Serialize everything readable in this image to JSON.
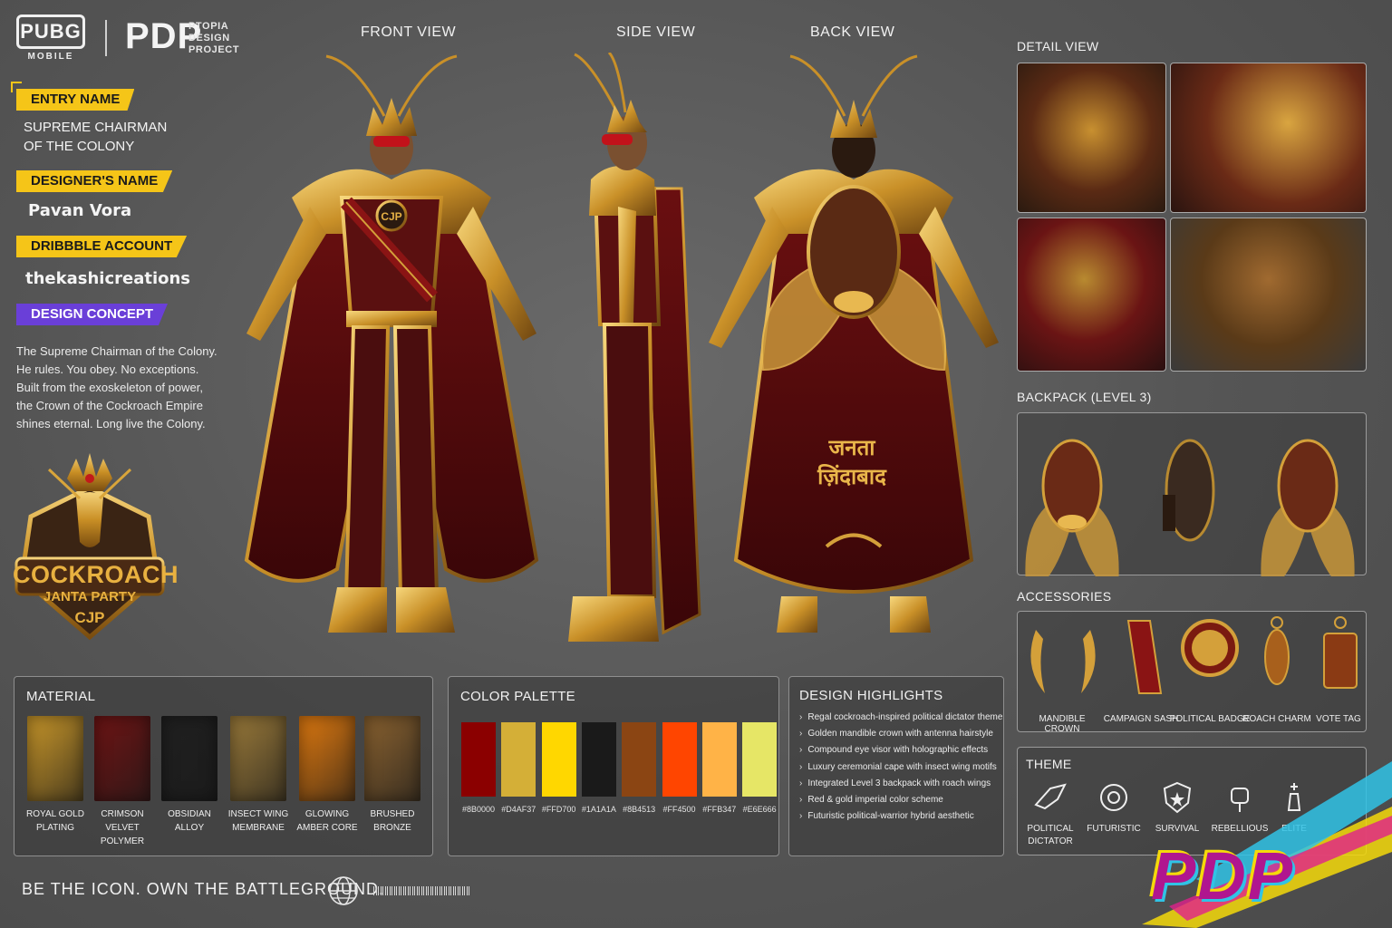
{
  "header": {
    "pubg_logo": "PUBG",
    "pubg_sub": "MOBILE",
    "pdp_logo": "PDP",
    "pdp_sub_1": "PTOPIA",
    "pdp_sub_2": "DESIGN",
    "pdp_sub_3": "PROJECT"
  },
  "entry": {
    "entry_tag": "ENTRY NAME",
    "entry_line1": "SUPREME CHAIRMAN",
    "entry_line2": "OF THE COLONY",
    "designer_tag": "DESIGNER'S NAME",
    "designer": "Pavan Vora",
    "dribbble_tag": "DRIBBBLE ACCOUNT",
    "dribbble": "thekashicreations",
    "concept_tag": "DESIGN CONCEPT",
    "concept": "The Supreme Chairman of the Colony. He rules. You obey. No exceptions. Built from the exoskeleton of power, the Crown of the Cockroach Empire shines eternal. Long live the Colony."
  },
  "emblem": {
    "line1": "COCKROACH",
    "line2": "JANTA PARTY",
    "line3": "CJP"
  },
  "views": {
    "front": "FRONT VIEW",
    "side": "SIDE VIEW",
    "back": "BACK VIEW",
    "chest_badge": "CJP",
    "cape_text_1": "जनता",
    "cape_text_2": "ज़िंदाबाद"
  },
  "detail": {
    "title": "DETAIL VIEW"
  },
  "backpack": {
    "title": "BACKPACK (LEVEL 3)"
  },
  "accessories": {
    "title": "ACCESSORIES",
    "items": [
      "MANDIBLE CROWN",
      "CAMPAIGN SASH",
      "POLITICAL BADGE",
      "ROACH CHARM",
      "VOTE TAG"
    ]
  },
  "material": {
    "title": "MATERIAL",
    "items": [
      {
        "l1": "ROYAL GOLD",
        "l2": "PLATING",
        "color": "#c9972a"
      },
      {
        "l1": "CRIMSON VELVET",
        "l2": "POLYMER",
        "color": "#6e1414"
      },
      {
        "l1": "OBSIDIAN",
        "l2": "ALLOY",
        "color": "#202020"
      },
      {
        "l1": "INSECT WING",
        "l2": "MEMBRANE",
        "color": "#9a7a3a"
      },
      {
        "l1": "GLOWING",
        "l2": "AMBER CORE",
        "color": "#e07a10"
      },
      {
        "l1": "BRUSHED",
        "l2": "BRONZE",
        "color": "#8a6230"
      }
    ]
  },
  "palette": {
    "title": "COLOR PALETTE",
    "colors": [
      "#8B0000",
      "#D4AF37",
      "#FFD700",
      "#1A1A1A",
      "#8B4513",
      "#FF4500",
      "#FFB347",
      "#E6E666"
    ],
    "labels": [
      "#8B0000",
      "#D4AF37",
      "#FFD700",
      "#1A1A1A",
      "#8B4513",
      "#FF4500",
      "#FFB347",
      "#E6E666"
    ]
  },
  "highlights": {
    "title": "DESIGN HIGHLIGHTS",
    "items": [
      "Regal cockroach-inspired political dictator theme",
      "Golden mandible crown with antenna hairstyle",
      "Compound eye visor with holographic effects",
      "Luxury ceremonial cape with insect wing motifs",
      "Integrated Level 3 backpack with roach wings",
      "Red & gold imperial color scheme",
      "Futuristic political-warrior hybrid aesthetic"
    ]
  },
  "theme": {
    "title": "THEME",
    "items": [
      {
        "l1": "POLITICAL",
        "l2": "DICTATOR"
      },
      {
        "l1": "FUTURISTIC",
        "l2": ""
      },
      {
        "l1": "SURVIVAL",
        "l2": ""
      },
      {
        "l1": "REBELLIOUS",
        "l2": ""
      },
      {
        "l1": "ELITE",
        "l2": ""
      }
    ]
  },
  "footer": {
    "tagline": "BE THE ICON. OWN THE BATTLEGROUND.",
    "brand": "PDP"
  }
}
